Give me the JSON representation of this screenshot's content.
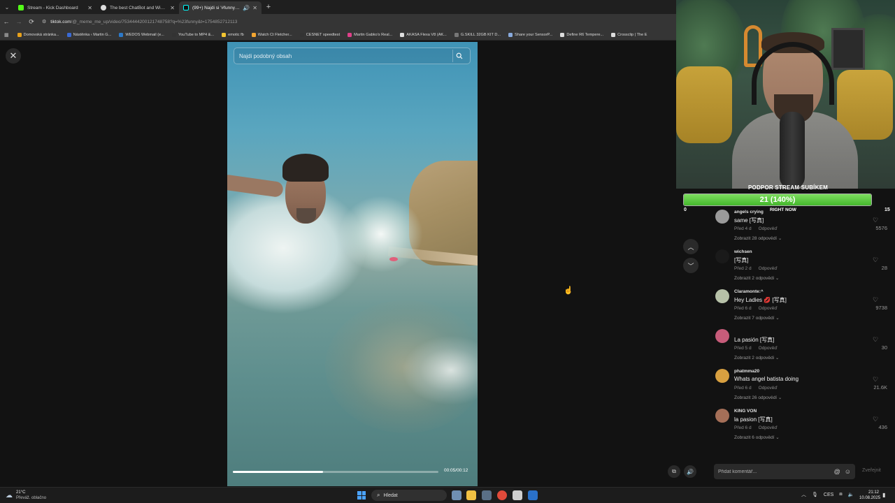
{
  "browser": {
    "tabs": [
      {
        "label": "Stream - Kick Dashboard",
        "color": "#53fc18",
        "active": false
      },
      {
        "label": "The best ChatBot and Widgets",
        "color": "#dddddd",
        "active": false
      },
      {
        "label": "(99+) Najdi si '#funny' na Ti",
        "color": "#ffffff",
        "active": true
      }
    ],
    "url_host": "tiktok.com",
    "url_path": "/@_meme_me_up/video/7534444200121748758?q=%23funny&t=1754852712113",
    "bookmarks": [
      {
        "label": "Domovská stránka...",
        "color": "#e7a11b"
      },
      {
        "label": "Nástěnka ‹ Martin G...",
        "color": "#3a6ad4"
      },
      {
        "label": "WEDOS Webmail (e...",
        "color": "#2c79c9"
      },
      {
        "label": "YouTube to MP4 &...",
        "color": "#333333"
      },
      {
        "label": "emotic fb",
        "color": "#f3c531"
      },
      {
        "label": "Watch Ct Fletcher...",
        "color": "#f3a531"
      },
      {
        "label": "CESNET speedtest",
        "color": "#333333"
      },
      {
        "label": "Martin Gabko's Real...",
        "color": "#e0408a"
      },
      {
        "label": "AKASA Flexa V8 (AK...",
        "color": "#dddddd"
      },
      {
        "label": "G.SKILL 32GB KIT D...",
        "color": "#777777"
      },
      {
        "label": "Share your SensorP...",
        "color": "#88aadd"
      },
      {
        "label": "Define R6 Tempere...",
        "color": "#dddddd"
      },
      {
        "label": "Crossclip | The E",
        "color": "#dddddd"
      }
    ]
  },
  "video": {
    "search_placeholder": "Najdi podobný obsah",
    "progress_fraction": 0.44,
    "timecode": "00:05/00:12"
  },
  "sub_goal": {
    "title": "PODPOR STREAM SUBÍKEM",
    "value_text": "21 (140%)",
    "fill_fraction": 1.0,
    "min": "0",
    "max": "15",
    "caption": "RIGHT NOW"
  },
  "comments": [
    {
      "user": "angels crying",
      "text": "same [写真]",
      "ago": "Před 4 d",
      "reply": "Odpověď",
      "view": "Zobrazit 28 odpovědí ⌄",
      "likes": "5576",
      "avatar_color": "#9a9a9a"
    },
    {
      "user": "wichsen",
      "text": "[写真]",
      "ago": "Před 2 d",
      "reply": "Odpověď",
      "view": "Zobrazit 2 odpovědi ⌄",
      "likes": "28",
      "avatar_color": "#1a1a1a"
    },
    {
      "user": "Claramonte:^",
      "text": "Hey Ladies 💋 [写真]",
      "ago": "Před 6 d",
      "reply": "Odpověď",
      "view": "Zobrazit 7 odpovědí ⌄",
      "likes": "9738",
      "avatar_color": "#b7c1a8"
    },
    {
      "user": "",
      "text": "La pasión [写真]",
      "ago": "Před 5 d",
      "reply": "Odpověď",
      "view": "Zobrazit 2 odpovědi ⌄",
      "likes": "30",
      "avatar_color": "#c75c7a"
    },
    {
      "user": "phatmma20",
      "text": "Whats angel batista doing",
      "ago": "Před 6 d",
      "reply": "Odpověď",
      "view": "Zobrazit 26 odpovědí ⌄",
      "likes": "21.6K",
      "avatar_color": "#d8a040"
    },
    {
      "user": "KING VON",
      "text": "la pasion [写真]",
      "ago": "Před 6 d",
      "reply": "Odpověď",
      "view": "Zobrazit 6 odpovědí ⌄",
      "likes": "436",
      "avatar_color": "#a56f58"
    }
  ],
  "comment_box": {
    "placeholder": "Přidat komentář...",
    "publish": "Zveřejnit"
  },
  "taskbar": {
    "temp": "21°C",
    "weather": "Převáž. oblačno",
    "search": "Hledat",
    "lang": "CES",
    "time": "21:12",
    "date": "10.08.2025",
    "apps": [
      "#6f8fb3",
      "#f0c043",
      "#5a6f86",
      "#e04a3a",
      "#cfcfcf",
      "#2a71c9"
    ]
  }
}
